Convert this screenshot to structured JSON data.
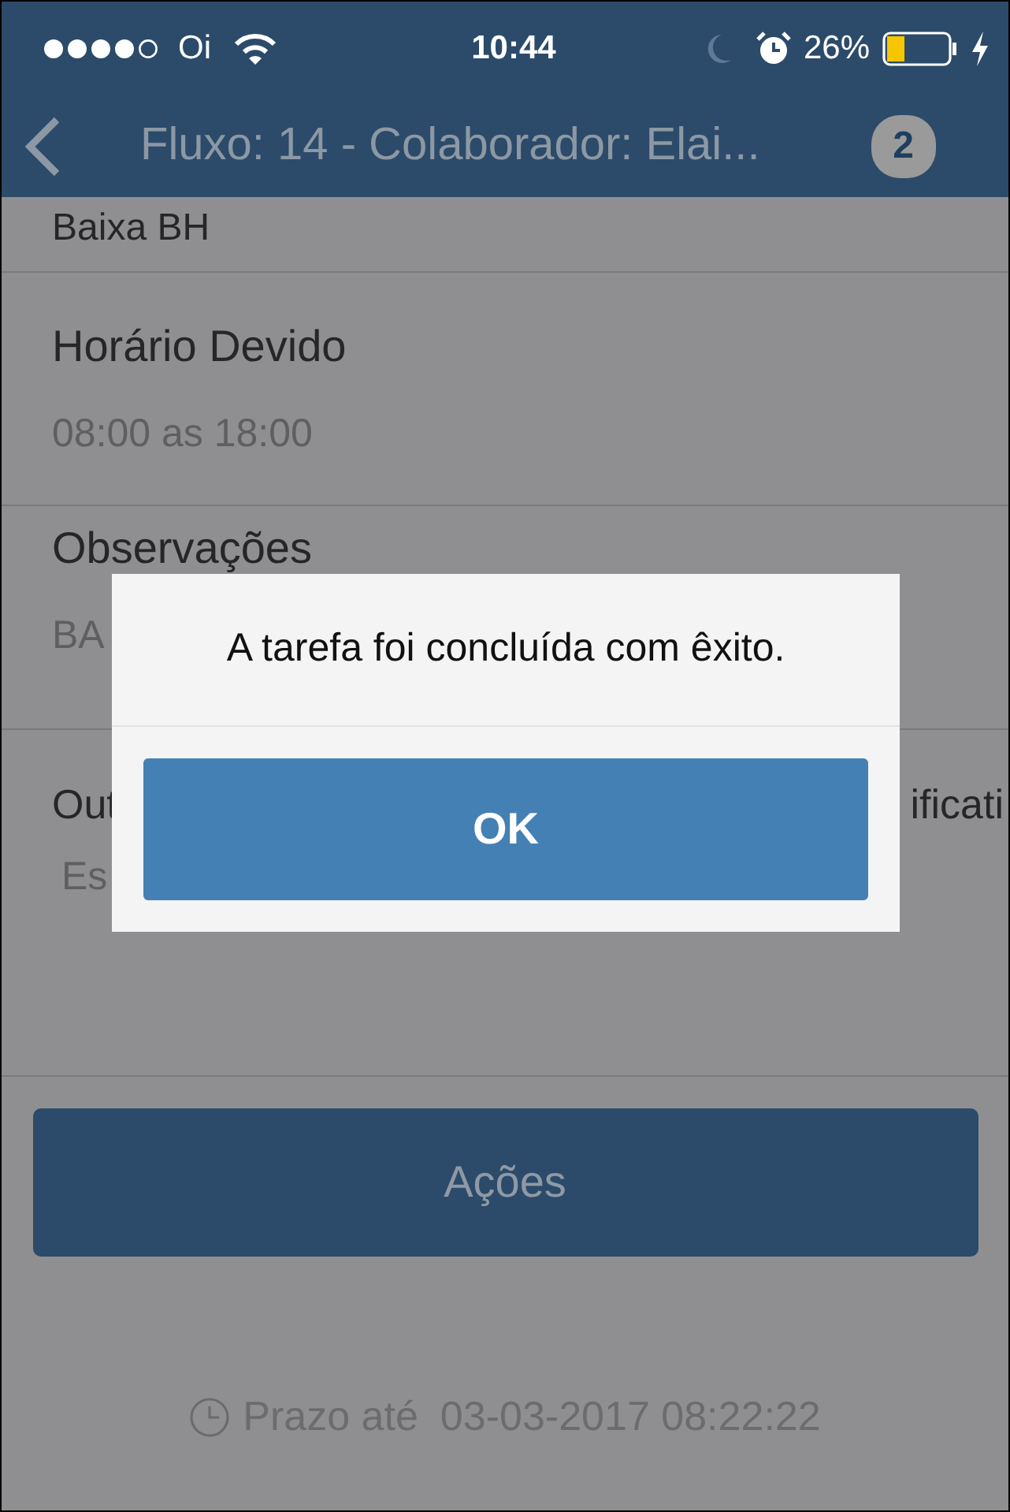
{
  "status_bar": {
    "carrier": "Oi",
    "time": "10:44",
    "battery": "26%"
  },
  "nav_bar": {
    "title": "Fluxo: 14 - Colaborador: Elai...",
    "badge": "2"
  },
  "fields": [
    {
      "kind": "value_only",
      "value": "Baixa BH"
    },
    {
      "kind": "full",
      "label": "Horário Devido",
      "value": "08:00 as 18:00"
    },
    {
      "kind": "full",
      "label": "Observações",
      "value": "BA"
    },
    {
      "kind": "split",
      "label_start": "Out",
      "label_end": "ificati",
      "value_start": "Es"
    }
  ],
  "actions_button": "Ações",
  "deadline": {
    "label": "Prazo até",
    "value": "03-03-2017 08:22:22"
  },
  "dialog": {
    "message": "A tarefa foi concluída com êxito.",
    "button": "OK"
  }
}
